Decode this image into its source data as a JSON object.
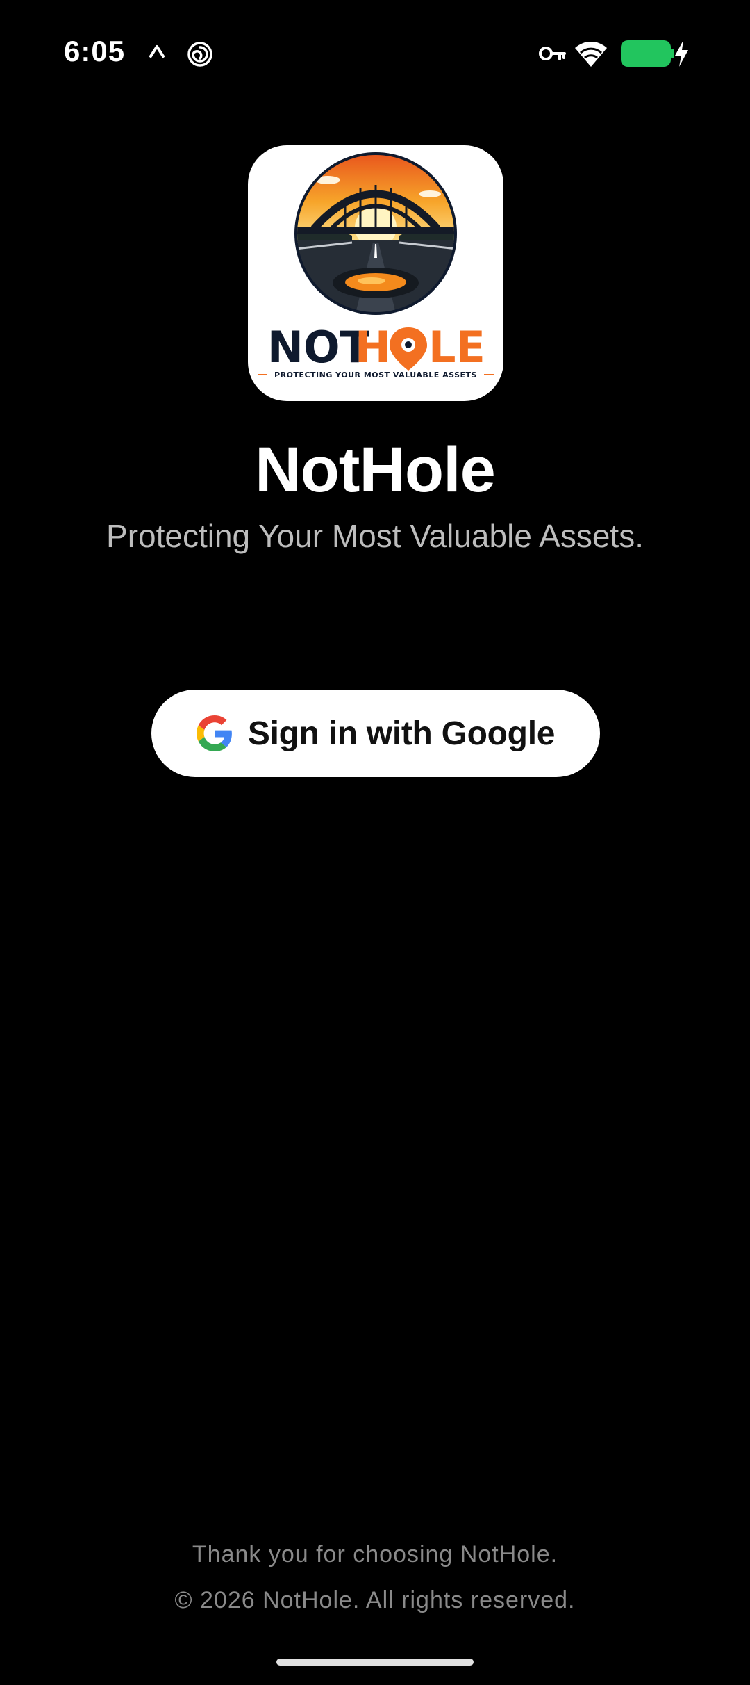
{
  "status_bar": {
    "time": "6:05",
    "left_icons": [
      "caret-up-icon",
      "spiral-icon"
    ],
    "right_icons": [
      "key-icon",
      "wifi-icon",
      "battery-charging-icon"
    ],
    "battery_color": "#22c55e"
  },
  "logo": {
    "wordmark_dark": "NOT",
    "wordmark_light_prefix": "H",
    "wordmark_light_suffix": "LE",
    "tagline": "PROTECTING YOUR MOST VALUABLE ASSETS",
    "brand_orange": "#f37021",
    "brand_navy": "#0f1a2e"
  },
  "header": {
    "title": "NotHole",
    "tagline": "Protecting Your Most Valuable Assets."
  },
  "sign_in": {
    "label": "Sign in with Google",
    "icon": "google-g-icon"
  },
  "footer": {
    "thanks": "Thank you for choosing NotHole.",
    "copyright": "© 2026 NotHole. All rights reserved."
  }
}
